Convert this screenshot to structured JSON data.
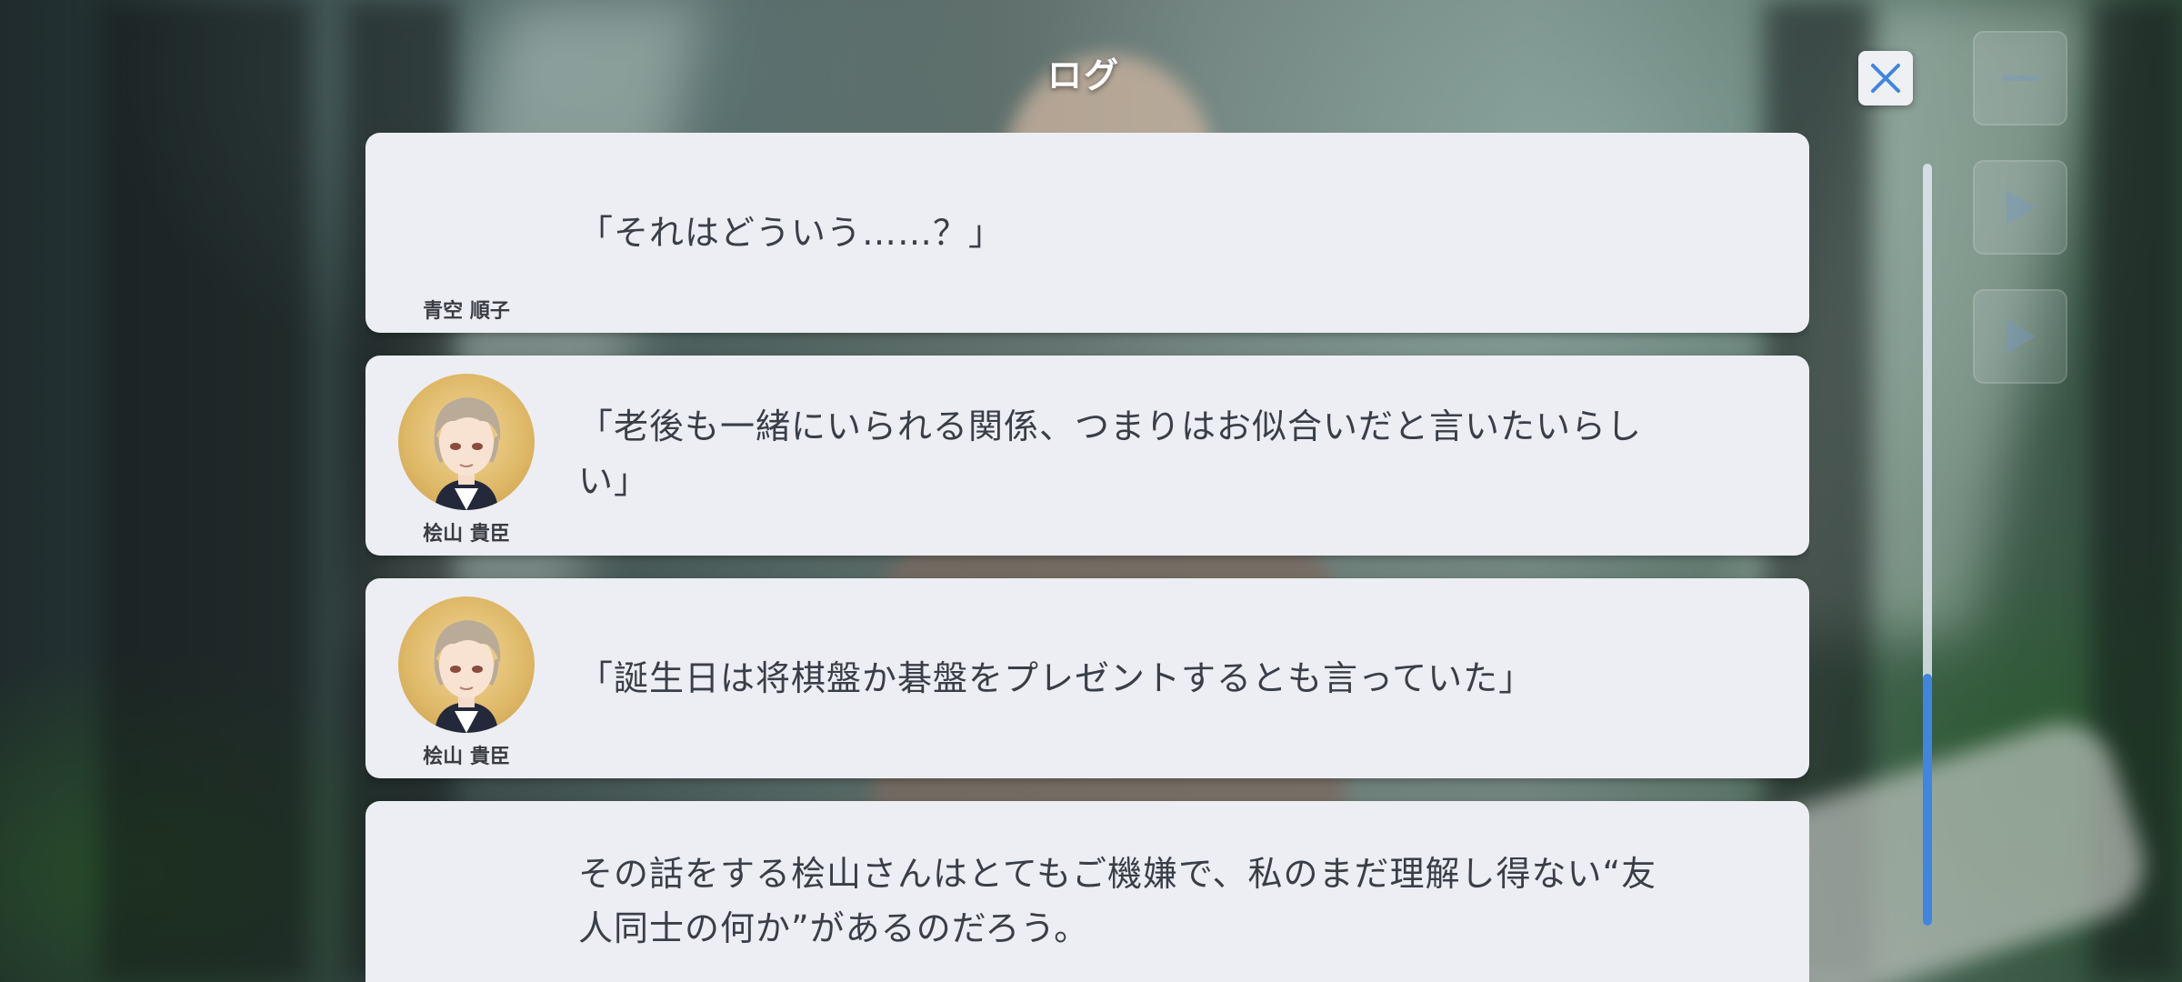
{
  "header": {
    "title": "ログ"
  },
  "entries": [
    {
      "speaker": "青空 順子",
      "text": "「それはどういう……？」",
      "has_avatar": false
    },
    {
      "speaker": "桧山 貴臣",
      "text": "「老後も一緒にいられる関係、つまりはお似合いだと言いたいらしい」",
      "has_avatar": true
    },
    {
      "speaker": "桧山 貴臣",
      "text": "「誕生日は将棋盤か碁盤をプレゼントするとも言っていた」",
      "has_avatar": true
    },
    {
      "speaker": "",
      "text": "その話をする桧山さんはとてもご機嫌で、私のまだ理解し得ない“友人同士の何か”があるのだろう。",
      "has_avatar": false
    }
  ],
  "icons": {
    "close": "close-icon",
    "menu": "menu-icon",
    "auto": "auto-play-icon",
    "skip": "skip-icon",
    "avatar": "character-portrait"
  },
  "scroll": {
    "position_fraction": 1.0,
    "visible_fraction": 0.33
  },
  "colors": {
    "accent": "#3f86e0",
    "card": "#eceef3",
    "text": "#3a3e48"
  }
}
